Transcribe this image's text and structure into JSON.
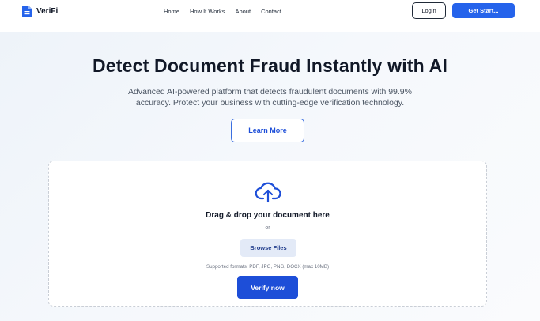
{
  "header": {
    "brand": "VeriFi",
    "nav": [
      "Home",
      "How It Works",
      "About",
      "Contact"
    ],
    "login_label": "Login",
    "cta_label": "Get Start..."
  },
  "hero": {
    "title": "Detect Document Fraud Instantly with AI",
    "subtitle": "Advanced AI-powered platform that detects fraudulent documents with 99.9% accuracy. Protect your business with cutting-edge verification technology.",
    "learn_more_label": "Learn More"
  },
  "upload": {
    "title": "Drag & drop your document here",
    "or_text": "or",
    "browse_label": "Browse Files",
    "formats_text": "Supported formats: PDF, JPG, PNG, DOCX (max 10MB)",
    "verify_label": "Verify now",
    "icon": "cloud-upload-icon"
  },
  "colors": {
    "accent": "#2563eb",
    "accent_dark": "#1d4ed8",
    "browse_bg": "#e3eaf7"
  }
}
